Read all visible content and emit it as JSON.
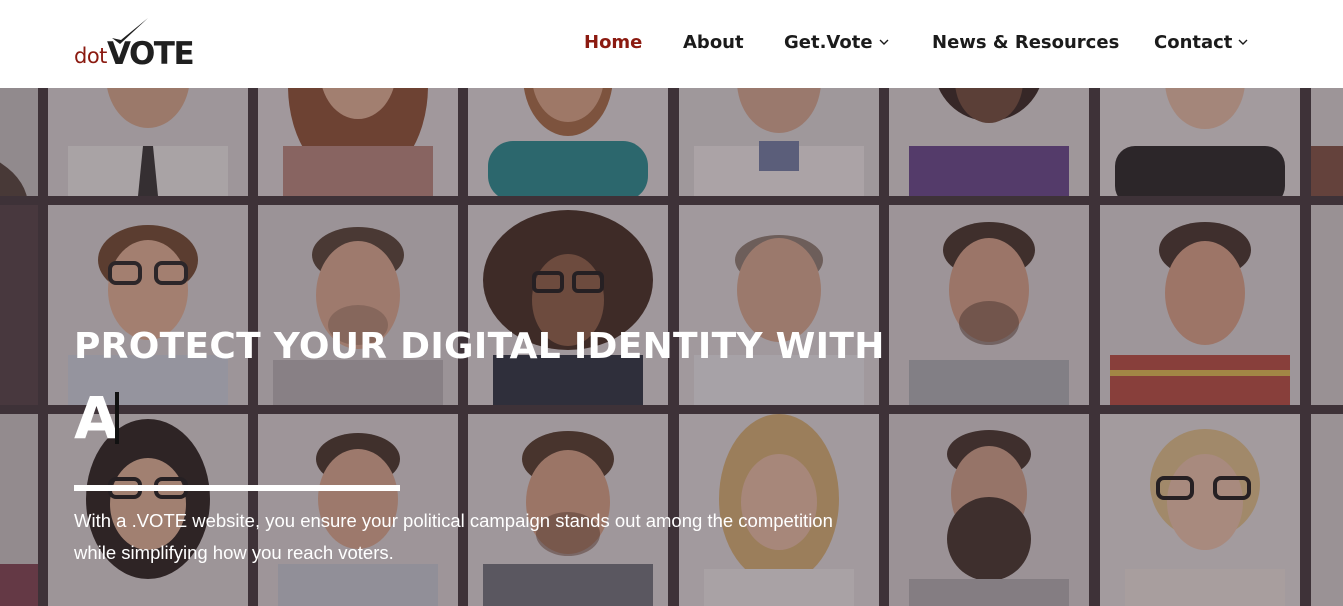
{
  "header": {
    "logo": {
      "prefix": "dot",
      "name": "VOTE",
      "brand_color": "#8b1a10",
      "check_icon": "checkmark-icon"
    },
    "nav": [
      {
        "label": "Home",
        "active": true,
        "has_dropdown": false
      },
      {
        "label": "About",
        "active": false,
        "has_dropdown": false
      },
      {
        "label": "Get.Vote",
        "active": false,
        "has_dropdown": true
      },
      {
        "label": "News & Resources",
        "active": false,
        "has_dropdown": false
      },
      {
        "label": "Contact",
        "active": false,
        "has_dropdown": true
      }
    ]
  },
  "hero": {
    "title": "PROTECT YOUR DIGITAL IDENTITY WITH",
    "typed_text": "A",
    "subtitle_line1": "With a .VOTE website, you ensure your political campaign stands out among the competition",
    "subtitle_line2": "while simplifying how you reach voters.",
    "background": "portrait-grid-image"
  },
  "colors": {
    "accent": "#8b1a10",
    "nav_text": "#1b1b1b",
    "overlay": "#46373e"
  }
}
